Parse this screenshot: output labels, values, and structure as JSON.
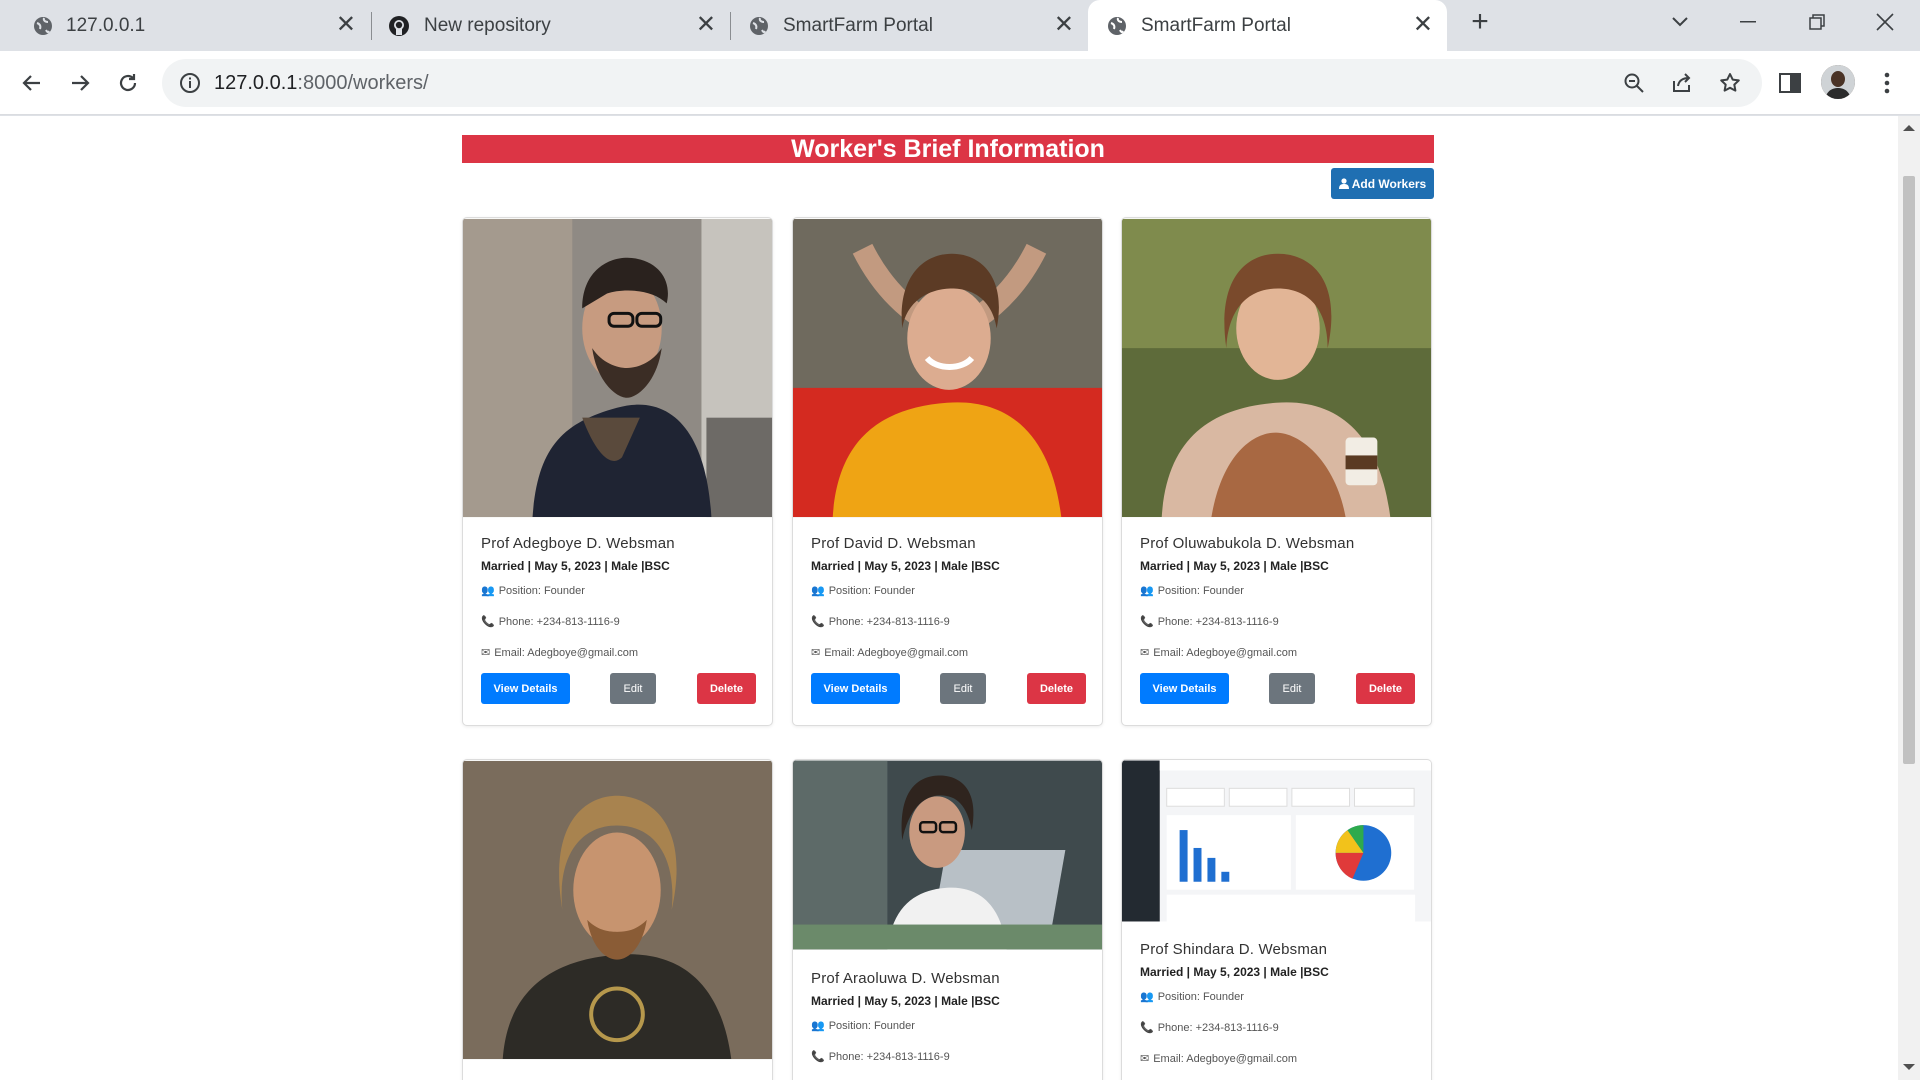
{
  "browser": {
    "tabs": [
      {
        "title": "127.0.0.1",
        "icon": "globe-icon",
        "active": false
      },
      {
        "title": "New repository",
        "icon": "github-icon",
        "active": false
      },
      {
        "title": "SmartFarm Portal",
        "icon": "globe-icon",
        "active": false
      },
      {
        "title": "SmartFarm Portal",
        "icon": "globe-icon",
        "active": true
      }
    ],
    "url_host": "127.0.0.1",
    "url_rest": ":8000/workers/"
  },
  "page": {
    "banner_title": "Worker's Brief Information",
    "add_workers_label": "Add Workers",
    "colors": {
      "banner": "#dc3545",
      "primary": "#007bff",
      "secondary": "#6c757d",
      "danger": "#dc3545",
      "add": "#1f6fb2"
    }
  },
  "workers": [
    {
      "name": "Prof Adegboye D. Websman",
      "meta": "Married | May 5, 2023 | Male |BSC",
      "position": "Position: Founder",
      "phone": "Phone: +234-813-1116-9",
      "email": "Email: Adegboye@gmail.com",
      "view": "View Details",
      "edit": "Edit",
      "delete": "Delete"
    },
    {
      "name": "Prof David D. Websman",
      "meta": "Married | May 5, 2023 | Male |BSC",
      "position": "Position: Founder",
      "phone": "Phone: +234-813-1116-9",
      "email": "Email: Adegboye@gmail.com",
      "view": "View Details",
      "edit": "Edit",
      "delete": "Delete"
    },
    {
      "name": "Prof Oluwabukola D. Websman",
      "meta": "Married | May 5, 2023 | Male |BSC",
      "position": "Position: Founder",
      "phone": "Phone: +234-813-1116-9",
      "email": "Email: Adegboye@gmail.com",
      "view": "View Details",
      "edit": "Edit",
      "delete": "Delete"
    },
    {
      "name": "",
      "meta": "",
      "position": "",
      "phone": "",
      "email": ""
    },
    {
      "name": "Prof Araoluwa D. Websman",
      "meta": "Married | May 5, 2023 | Male |BSC",
      "position": "Position: Founder",
      "phone": "Phone: +234-813-1116-9"
    },
    {
      "name": "Prof Shindara D. Websman",
      "meta": "Married | May 5, 2023 | Male |BSC",
      "position": "Position: Founder",
      "phone": "Phone: +234-813-1116-9",
      "email": "Email: Adegboye@gmail.com"
    }
  ]
}
